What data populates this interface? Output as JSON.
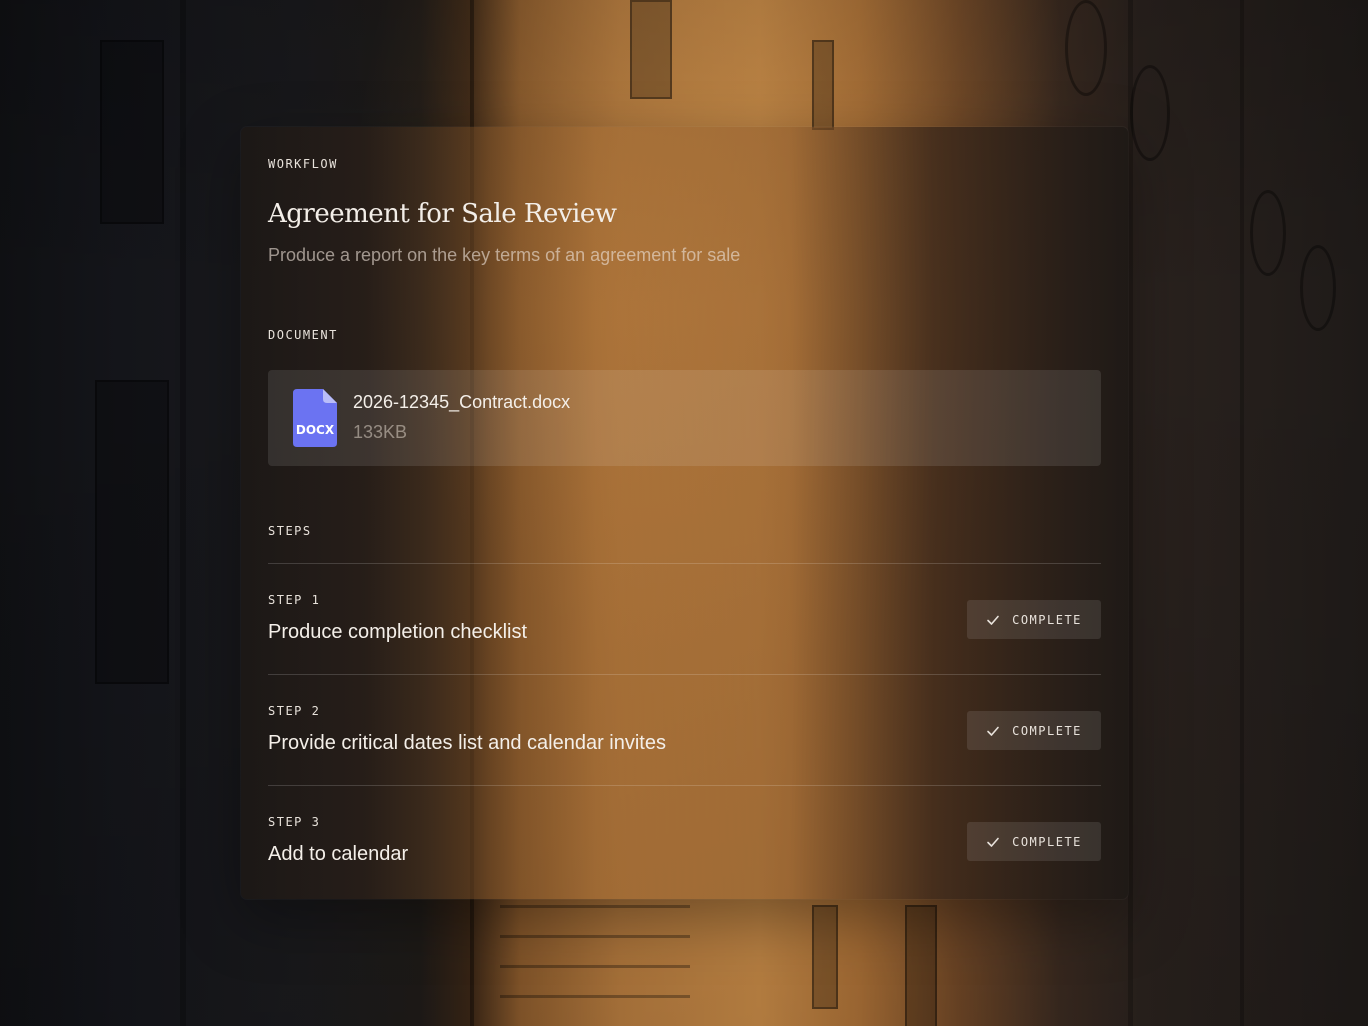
{
  "workflow": {
    "section_label": "WORKFLOW",
    "title": "Agreement for Sale Review",
    "description": "Produce a report on the key terms of an agreement for sale"
  },
  "document": {
    "section_label": "DOCUMENT",
    "file_name": "2026-12345_Contract.docx",
    "file_size": "133KB",
    "file_type_label": "DOCX",
    "icon": "docx-file-icon",
    "icon_color": "#6b73f2"
  },
  "steps": {
    "section_label": "STEPS",
    "items": [
      {
        "number_label": "STEP 1",
        "title": "Produce completion checklist",
        "status": "COMPLETE",
        "status_icon": "check-icon"
      },
      {
        "number_label": "STEP 2",
        "title": "Provide critical dates list and calendar invites",
        "status": "COMPLETE",
        "status_icon": "check-icon"
      },
      {
        "number_label": "STEP 3",
        "title": "Add to calendar",
        "status": "COMPLETE",
        "status_icon": "check-icon"
      }
    ]
  }
}
